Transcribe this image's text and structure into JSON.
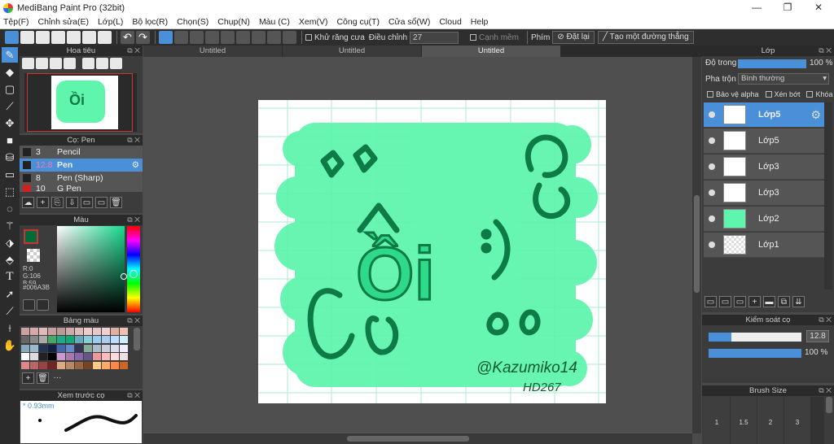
{
  "app": {
    "title": "MediBang Paint Pro (32bit)"
  },
  "menu": [
    "Tệp(F)",
    "Chỉnh sửa(E)",
    "Lớp(L)",
    "Bộ lọc(R)",
    "Chọn(S)",
    "Chụp(N)",
    "Màu (C)",
    "Xem(V)",
    "Công cụ(T)",
    "Cửa sổ(W)",
    "Cloud",
    "Help"
  ],
  "toolbar": {
    "antialias": "Khử răng cưa",
    "adjust_label": "Điều chỉnh",
    "adjust_value": "27",
    "soft_edge": "Cạnh mềm",
    "keys": "Phím",
    "reset": "Đặt lại",
    "new_straight": "Tạo một đường thẳng"
  },
  "tabs": [
    "Untitled",
    "Untitled",
    "Untitled"
  ],
  "navigator": {
    "title": "Hoa tiêu"
  },
  "brush": {
    "title": "Cọ: Pen",
    "items": [
      {
        "size": "3",
        "name": "Pencil",
        "color": "#222222"
      },
      {
        "size": "12.8",
        "name": "Pen",
        "color": "#222222"
      },
      {
        "size": "8",
        "name": "Pen (Sharp)",
        "color": "#222222"
      },
      {
        "size": "10",
        "name": "G Pen",
        "color": "#cc2222"
      }
    ]
  },
  "color": {
    "title": "Màu",
    "r": "R:0",
    "g": "G:106",
    "b": "B:59",
    "hex": "#006A3B",
    "main": "#006A3B",
    "hue": "#19d98f"
  },
  "palette": {
    "title": "Bảng màu"
  },
  "brush_preview": {
    "title": "Xem trước cọ",
    "size": "0.93mm"
  },
  "layers": {
    "title": "Lớp",
    "opacity_label": "Độ trong",
    "opacity_value": "100 %",
    "blend_label": "Pha trộn",
    "blend_value": "Bình thường",
    "protect_alpha": "Bảo vệ alpha",
    "clip": "Xén bớt",
    "lock": "Khóa",
    "items": [
      {
        "name": "Lớp5",
        "selected": true
      },
      {
        "name": "Lớp5",
        "selected": false
      },
      {
        "name": "Lớp3",
        "selected": false
      },
      {
        "name": "Lớp3",
        "selected": false
      },
      {
        "name": "Lớp2",
        "selected": false
      },
      {
        "name": "Lớp1",
        "selected": false
      }
    ]
  },
  "brush_control": {
    "title": "Kiểm soát cọ",
    "size": "12.8",
    "opacity": "100 %"
  },
  "brush_size": {
    "title": "Brush Size",
    "ticks": [
      "1",
      "1.5",
      "2",
      "3"
    ]
  },
  "canvas": {
    "signature_line1": "@Kazumiko14",
    "signature_line2": "HD267",
    "text_main": "Ồi",
    "colors": {
      "blob": "#5ff5ad",
      "ink": "#0e7a45",
      "grid": "#a8ebd0"
    }
  }
}
